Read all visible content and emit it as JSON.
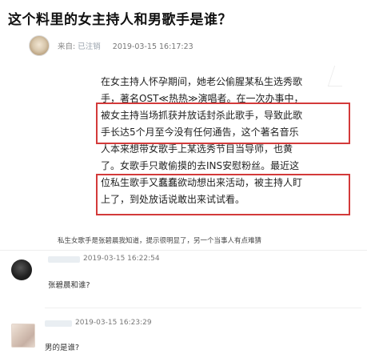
{
  "post": {
    "title": "这个料里的女主持人和男歌手是谁？",
    "author_prefix": "来自:",
    "author_name": "已注销",
    "timestamp": "2019-03-15 16:17:23"
  },
  "screenshot": {
    "lines": [
      "在女主持人怀孕期间，她老公偷腥某私生选秀歌",
      "手，著名OST≪热热≫演唱者。在一次办事中，",
      "被女主持当场抓获并放话封杀此歌手，导致此歌",
      "手长达5个月至今没有任何通告，这个著名音乐",
      "人本来想带女歌手上某选秀节目当导师，也黄",
      "了。女歌手只敢偷摸的去INS安慰粉丝。最近这",
      "位私生歌手又蠢蠢欲动想出来活动，被主持人盯",
      "上了，到处放话说敢出来试试看。"
    ]
  },
  "caption": "私生女歌手是张碧晨我知道，提示很明显了，另一个当事人有点难猜",
  "comments": [
    {
      "timestamp": "2019-03-15 16:22:54",
      "text": "张碧晨和谁?"
    },
    {
      "timestamp": "2019-03-15 16:23:29",
      "text": "男的是谁?"
    }
  ],
  "colors": {
    "highlight_border": "#d33a3a",
    "meta_gray": "#888888"
  }
}
